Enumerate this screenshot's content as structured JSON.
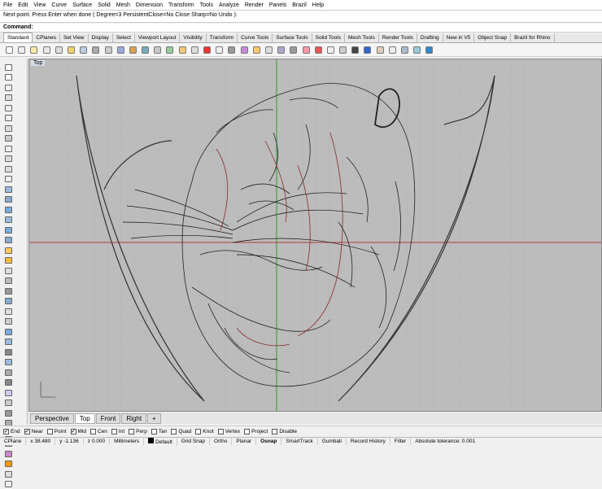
{
  "menu": [
    "File",
    "Edit",
    "View",
    "Curve",
    "Surface",
    "Solid",
    "Mesh",
    "Dimension",
    "Transform",
    "Tools",
    "Analyze",
    "Render",
    "Panels",
    "Brazil",
    "Help"
  ],
  "command_history": "Next point. Press Enter when done ( Degree=3  PersistentClose=No  Close  Sharp=No  Undo ):",
  "command_prompt": "Command:",
  "tabs": [
    "Standard",
    "CPlanes",
    "Set View",
    "Display",
    "Select",
    "Viewport Layout",
    "Visibility",
    "Transform",
    "Curve Tools",
    "Surface Tools",
    "Solid Tools",
    "Mesh Tools",
    "Render Tools",
    "Drafting",
    "New in V5",
    "Object Snap",
    "Brazil for Rhino"
  ],
  "active_tab": "Standard",
  "viewport_title": "Top",
  "viewport_tabs": [
    "Perspective",
    "Top",
    "Front",
    "Right",
    "+"
  ],
  "active_viewport_tab": "Top",
  "osnaps": [
    {
      "label": "End",
      "checked": true
    },
    {
      "label": "Near",
      "checked": true
    },
    {
      "label": "Point",
      "checked": false
    },
    {
      "label": "Mid",
      "checked": true
    },
    {
      "label": "Cen",
      "checked": false
    },
    {
      "label": "Int",
      "checked": false
    },
    {
      "label": "Perp",
      "checked": false
    },
    {
      "label": "Tan",
      "checked": false
    },
    {
      "label": "Quad",
      "checked": false
    },
    {
      "label": "Knot",
      "checked": false
    },
    {
      "label": "Vertex",
      "checked": false
    },
    {
      "label": "Project",
      "checked": false
    },
    {
      "label": "Disable",
      "checked": false
    }
  ],
  "status": {
    "cplane": "CPlane",
    "x": "x 38.480",
    "y": "y -1.136",
    "z": "z 0.000",
    "units": "Millimeters",
    "layer": "Default",
    "toggles": [
      "Grid Snap",
      "Ortho",
      "Planar",
      "Osnap",
      "SmartTrack",
      "Gumball",
      "Record History",
      "Filter"
    ],
    "active_toggle": "Osnap",
    "tolerance": "Absolute tolerance: 0.001"
  }
}
